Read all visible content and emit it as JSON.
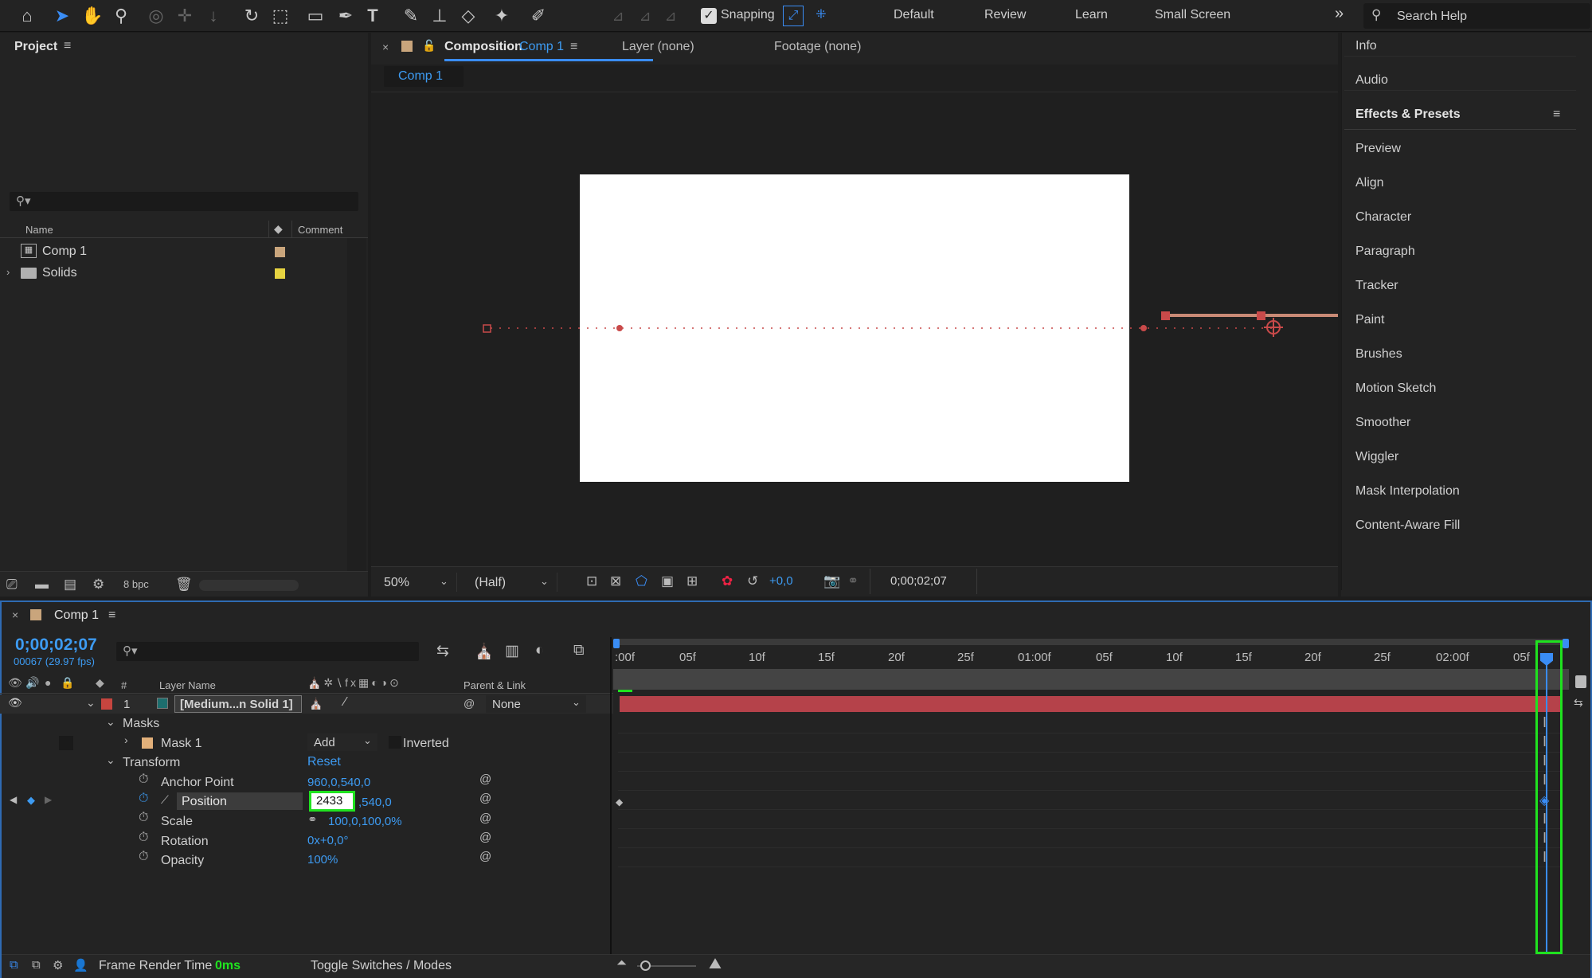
{
  "toolbar": {
    "snapping_label": "Snapping",
    "workspaces": [
      "Default",
      "Review",
      "Learn",
      "Small Screen"
    ],
    "overflow_icon": "chevron-double-right-icon",
    "search_placeholder": "Search Help",
    "accent": "#3a8df5"
  },
  "project": {
    "title": "Project",
    "search_placeholder": "",
    "columns": {
      "name": "Name",
      "comment": "Comment"
    },
    "items": [
      {
        "name": "Comp 1",
        "label_color": "#c9a57c"
      },
      {
        "name": "Solids",
        "label_color": "#e6d341"
      }
    ],
    "bit_depth": "8 bpc"
  },
  "comp_panel": {
    "tab_prefix": "Composition",
    "tab_comp": "Comp 1",
    "layer_tab": "Layer (none)",
    "footage_tab": "Footage (none)",
    "breadcrumb": "Comp 1",
    "zoom": "50%",
    "resolution": "(Half)",
    "exposure": "+0,0",
    "timecode": "0;00;02;07",
    "canvas_color": "#ffffff",
    "path_color": "#c94a4a"
  },
  "right_panel": {
    "items": [
      "Info",
      "Audio",
      "Effects & Presets",
      "Preview",
      "Align",
      "Character",
      "Paragraph",
      "Tracker",
      "Paint",
      "Brushes",
      "Motion Sketch",
      "Smoother",
      "Wiggler",
      "Mask Interpolation",
      "Content-Aware Fill"
    ],
    "active": "Effects & Presets"
  },
  "timeline": {
    "tab": "Comp 1",
    "current_time": "0;00;02;07",
    "frame_info": "00067 (29.97 fps)",
    "headers": {
      "num": "#",
      "layer_name": "Layer Name",
      "parent": "Parent & Link"
    },
    "layer": {
      "index": "1",
      "name": "[Medium...n Solid 1]",
      "parent": "None",
      "color": "#c6453f"
    },
    "masks_label": "Masks",
    "mask": {
      "name": "Mask 1",
      "mode": "Add",
      "inverted": "Inverted"
    },
    "transform": {
      "label": "Transform",
      "reset": "Reset"
    },
    "properties": [
      {
        "name": "Anchor Point",
        "value": "960,0,540,0"
      },
      {
        "name": "Position",
        "value_edit": "2433",
        "value_rest": ",540,0"
      },
      {
        "name": "Scale",
        "value": "100,0,100,0%"
      },
      {
        "name": "Rotation",
        "value": "0x+0,0°"
      },
      {
        "name": "Opacity",
        "value": "100%"
      }
    ],
    "ruler": [
      ":00f",
      "05f",
      "10f",
      "15f",
      "20f",
      "25f",
      "01:00f",
      "05f",
      "10f",
      "15f",
      "20f",
      "25f",
      "02:00f",
      "05f"
    ],
    "bar_color": "#b5424a",
    "highlight_color": "#1fe21f",
    "footer": {
      "render_label": "Frame Render Time",
      "render_value": "0ms",
      "toggle": "Toggle Switches / Modes"
    }
  }
}
